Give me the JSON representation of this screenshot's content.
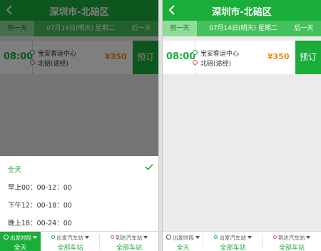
{
  "colors": {
    "brand_green": "#1aad3a",
    "price_orange": "#f08a1c",
    "to_dot_red": "#e0566b"
  },
  "header": {
    "title": "深圳市-北碚区",
    "back_icon": "chevron-left-icon"
  },
  "date_bar": {
    "prev_label": "前一天",
    "date_label": "07月14日(明天) 星期二",
    "next_label": "后一天"
  },
  "trip": {
    "departure_time": "08:00",
    "from_station": "宝安客运中心",
    "to_station": "北碚(途经)",
    "price": "¥350",
    "book_label": "预订"
  },
  "time_filter": {
    "selected_index": 0,
    "options": [
      "全天",
      "早上00：00-12：00",
      "下午12：00-18：00",
      "晚上18：00-24：00"
    ]
  },
  "bottom_tabs": [
    {
      "label": "出发时段",
      "value": "全天",
      "icon": "clock-icon"
    },
    {
      "label": "出发汽车站",
      "value": "全部车站",
      "icon": "green-dot-icon"
    },
    {
      "label": "到达汽车站",
      "value": "全部车站",
      "icon": "red-dot-icon"
    }
  ]
}
